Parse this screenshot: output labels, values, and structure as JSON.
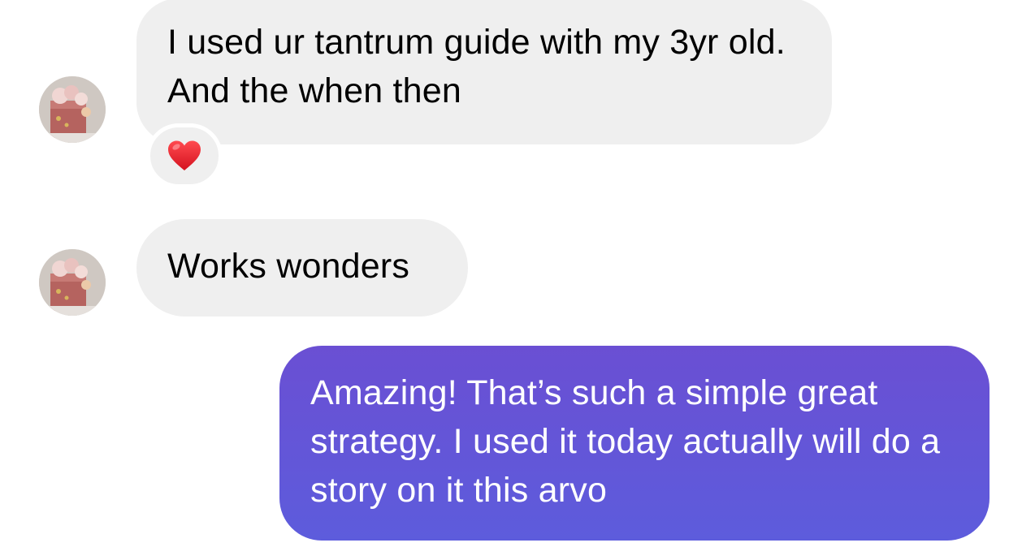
{
  "messages": [
    {
      "direction": "incoming",
      "text": "I used ur tantrum guide with my 3yr old. And the when then",
      "reaction": {
        "emoji": "❤️",
        "icon": "red-heart-icon"
      }
    },
    {
      "direction": "incoming",
      "text": "Works wonders"
    },
    {
      "direction": "outgoing",
      "text": "Amazing! That’s such a simple great strategy. I used it today actually will do a story on it this arvo"
    }
  ],
  "sender": {
    "avatar_icon": "profile-photo-avatar"
  },
  "colors": {
    "incoming_bubble": "#efefef",
    "outgoing_bubble_top": "#6a4fd3",
    "outgoing_bubble_bottom": "#5d5cdc",
    "reaction_heart": "#e8212f"
  }
}
